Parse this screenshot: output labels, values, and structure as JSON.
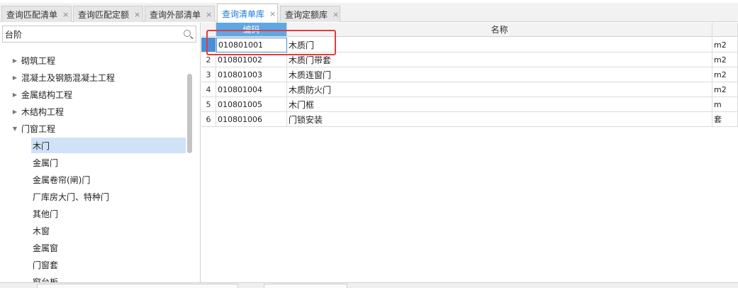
{
  "tabs": [
    {
      "label": "查询匹配清单",
      "active": false
    },
    {
      "label": "查询匹配定额",
      "active": false
    },
    {
      "label": "查询外部清单",
      "active": false
    },
    {
      "label": "查询清单库",
      "active": true
    },
    {
      "label": "查询定额库",
      "active": false
    }
  ],
  "close_glyph": "×",
  "search": {
    "value": "台阶",
    "icon": "search-icon"
  },
  "tree": {
    "collapsed_arrow": "▶",
    "expanded_arrow": "▼",
    "items": [
      {
        "label": "砌筑工程"
      },
      {
        "label": "混凝土及钢筋混凝土工程"
      },
      {
        "label": "金属结构工程"
      },
      {
        "label": "木结构工程"
      },
      {
        "label": "门窗工程"
      },
      {
        "label": "木门"
      },
      {
        "label": "金属门"
      },
      {
        "label": "金属卷帘(闸)门"
      },
      {
        "label": "厂库房大门、特种门"
      },
      {
        "label": "其他门"
      },
      {
        "label": "木窗"
      },
      {
        "label": "金属窗"
      },
      {
        "label": "门窗套"
      },
      {
        "label": "窗台板"
      }
    ]
  },
  "table": {
    "headers": {
      "code": "编码",
      "name": "名称"
    },
    "rows": [
      {
        "num": "",
        "code": "010801001",
        "name": "木质门",
        "unit": "m2"
      },
      {
        "num": "2",
        "code": "010801002",
        "name": "木质门带套",
        "unit": "m2"
      },
      {
        "num": "3",
        "code": "010801003",
        "name": "木质连窗门",
        "unit": "m2"
      },
      {
        "num": "4",
        "code": "010801004",
        "name": "木质防火门",
        "unit": "m2"
      },
      {
        "num": "5",
        "code": "010801005",
        "name": "木门框",
        "unit": "m"
      },
      {
        "num": "6",
        "code": "010801006",
        "name": "门锁安装",
        "unit": "套"
      }
    ]
  },
  "colors": {
    "accent": "#1e7ad6",
    "highlight": "#e23b3b",
    "selected": "#cfe2f8"
  }
}
